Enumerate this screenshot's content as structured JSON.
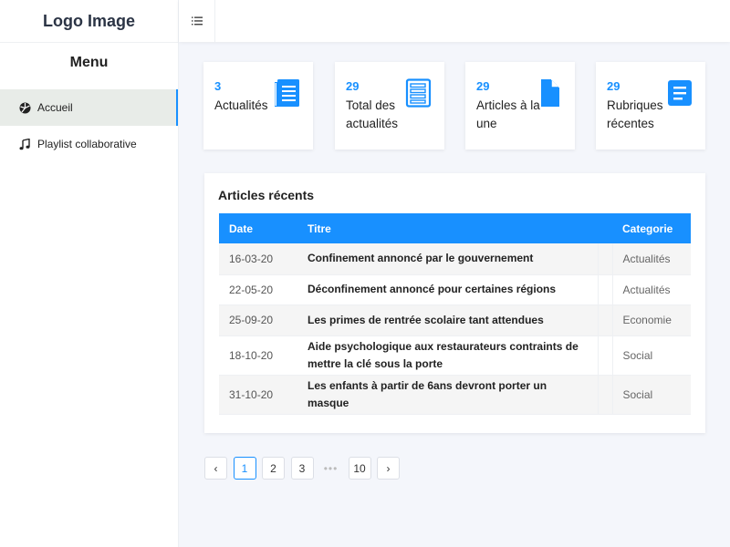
{
  "sidebar": {
    "logo": "Logo Image",
    "menu_title": "Menu",
    "items": [
      {
        "label": "Accueil",
        "icon": "dashboard-icon",
        "active": true
      },
      {
        "label": "Playlist collaborative",
        "icon": "music-note-icon",
        "active": false
      }
    ]
  },
  "header": {
    "menu_toggle_icon": "hamburger-icon"
  },
  "stats": [
    {
      "value": "3",
      "label": "Actualités",
      "icon": "list-document-icon"
    },
    {
      "value": "29",
      "label": "Total des actualités",
      "icon": "form-list-icon"
    },
    {
      "value": "29",
      "label": "Articles à la une",
      "icon": "file-icon"
    },
    {
      "value": "29",
      "label": "Rubriques récentes",
      "icon": "menu-box-icon"
    }
  ],
  "articles": {
    "title": "Articles récents",
    "columns": [
      "Date",
      "Titre",
      "Categorie"
    ],
    "rows": [
      {
        "date": "16-03-20",
        "title": "Confinement annoncé par le gouvernement",
        "category": "Actualités"
      },
      {
        "date": "22-05-20",
        "title": "Déconfinement annoncé pour certaines régions",
        "category": "Actualités"
      },
      {
        "date": "25-09-20",
        "title": "Les primes de rentrée scolaire tant attendues",
        "category": "Economie"
      },
      {
        "date": "18-10-20",
        "title": "Aide psychologique aux restaurateurs contraints de mettre la clé sous la porte",
        "category": "Social"
      },
      {
        "date": "31-10-20",
        "title": "Les enfants à partir de 6ans devront porter un masque",
        "category": "Social"
      }
    ]
  },
  "pagination": {
    "prev": "‹",
    "next": "›",
    "pages": [
      "1",
      "2",
      "3",
      "•••",
      "10"
    ],
    "current": "1"
  },
  "colors": {
    "accent": "#1890ff",
    "active_bg": "#e8ece8"
  }
}
